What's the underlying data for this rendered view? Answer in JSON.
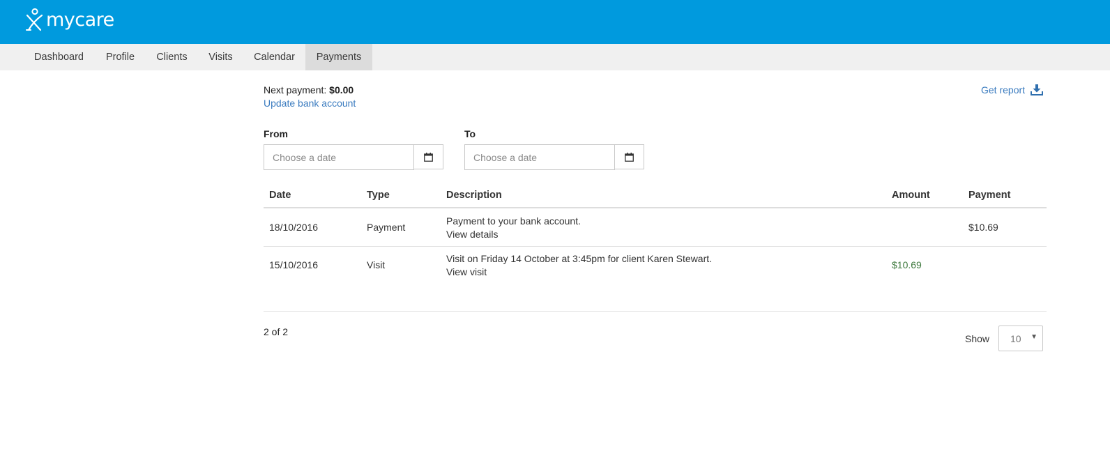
{
  "brand": {
    "name": "mycare"
  },
  "nav": {
    "items": [
      {
        "label": "Dashboard"
      },
      {
        "label": "Profile"
      },
      {
        "label": "Clients"
      },
      {
        "label": "Visits"
      },
      {
        "label": "Calendar"
      },
      {
        "label": "Payments",
        "active": true
      }
    ]
  },
  "summary": {
    "next_payment_label": "Next payment:",
    "next_payment_value": "$0.00",
    "update_bank_link": "Update bank account",
    "get_report_link": "Get report"
  },
  "filters": {
    "from_label": "From",
    "from_placeholder": "Choose a date",
    "from_value": "",
    "to_label": "To",
    "to_placeholder": "Choose a date",
    "to_value": ""
  },
  "table": {
    "headers": [
      "Date",
      "Type",
      "Description",
      "Amount",
      "Payment"
    ],
    "rows": [
      {
        "date": "18/10/2016",
        "type": "Payment",
        "description": "Payment to your bank account.",
        "link": "View details",
        "amount": "",
        "payment": "$10.69"
      },
      {
        "date": "15/10/2016",
        "type": "Visit",
        "description": "Visit on Friday 14 October at 3:45pm for client Karen Stewart.",
        "link": "View visit",
        "amount": "$10.69",
        "payment": ""
      }
    ]
  },
  "pagination": {
    "count_text": "2 of 2",
    "show_label": "Show",
    "show_value": "10"
  },
  "colors": {
    "header_blue": "#009ade",
    "link_blue": "#3a7bbf",
    "amount_green": "#3f7a3f"
  }
}
